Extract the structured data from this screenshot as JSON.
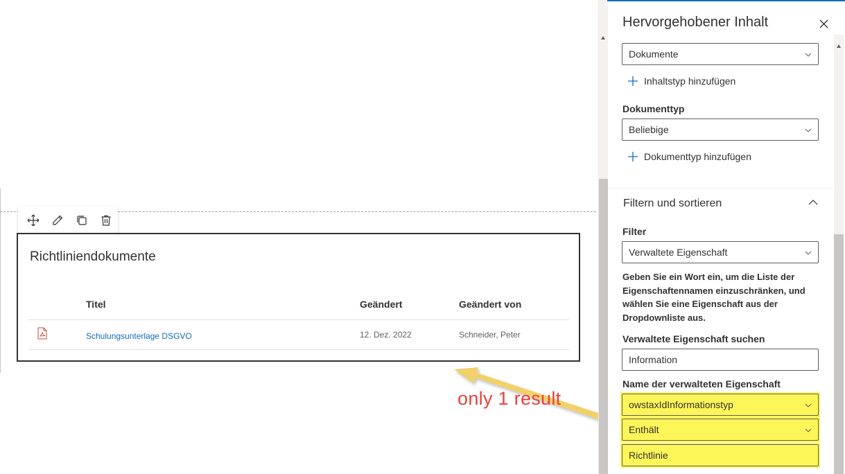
{
  "toolbar": {
    "icons": [
      "move-icon",
      "edit-icon",
      "duplicate-icon",
      "delete-icon"
    ]
  },
  "webpart": {
    "title": "Richtliniendokumente",
    "columns": [
      "Titel",
      "Geändert",
      "Geändert von"
    ],
    "rows": [
      {
        "icon": "pdf-document-icon",
        "title": "Schulungsunterlage DSGVO",
        "modified": "12. Dez. 2022",
        "modified_by": "Schneider, Peter"
      }
    ]
  },
  "annotation": {
    "text": "only 1 result",
    "color": "#e8413c",
    "arrow_color": "#f2d06b"
  },
  "pane": {
    "title": "Hervorgehobener Inhalt",
    "content_type_value": "Dokumente",
    "add_content_type": "Inhaltstyp hinzufügen",
    "document_type_label": "Dokumenttyp",
    "document_type_value": "Beliebige",
    "add_document_type": "Dokumenttyp hinzufügen",
    "filter_group": "Filtern und sortieren",
    "filter_label": "Filter",
    "filter_value": "Verwaltete Eigenschaft",
    "filter_description": "Geben Sie ein Wort ein, um die Liste der Eigenschaftennamen einzuschränken, und wählen Sie eine Eigenschaft aus der Dropdownliste aus.",
    "search_label": "Verwaltete Eigenschaft suchen",
    "search_value": "Information",
    "property_name_label": "Name der verwalteten Eigenschaft",
    "property_name_value": "owstaxIdInformationstyp",
    "operator_value": "Enthält",
    "filter_text_value": "Richtlinie"
  },
  "colors": {
    "accent": "#0f6cbd",
    "highlight": "#fdf659",
    "link": "#0f6cbd"
  }
}
